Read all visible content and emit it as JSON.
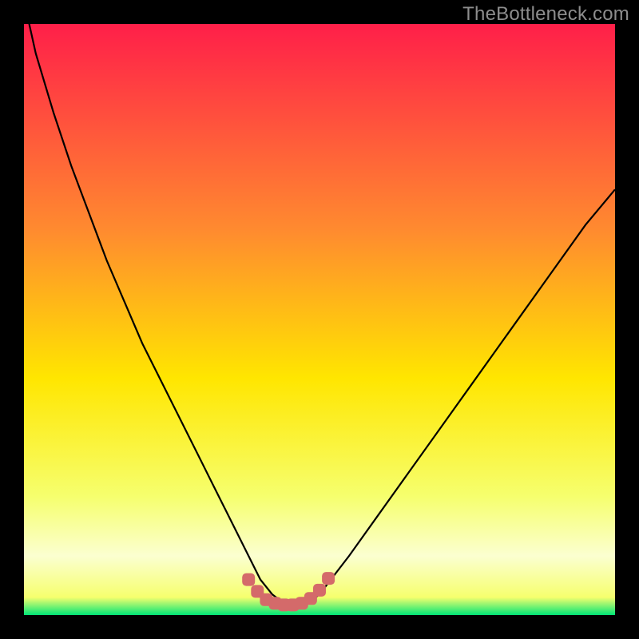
{
  "watermark": "TheBottleneck.com",
  "colors": {
    "frame": "#000000",
    "gradient_top": "#ff1f49",
    "gradient_mid_upper": "#ff8b2f",
    "gradient_mid": "#ffe600",
    "gradient_lower": "#f6ff6e",
    "gradient_band": "#fbffd0",
    "gradient_bottom": "#00e676",
    "curve": "#000000",
    "marker": "#d46a6a"
  },
  "chart_data": {
    "type": "line",
    "title": "",
    "xlabel": "",
    "ylabel": "",
    "xlim": [
      0,
      100
    ],
    "ylim": [
      0,
      100
    ],
    "grid": false,
    "series": [
      {
        "name": "bottleneck-curve",
        "x": [
          0,
          2,
          5,
          8,
          11,
          14,
          17,
          20,
          23,
          26,
          29,
          32,
          34,
          36,
          38,
          40,
          42,
          44,
          46,
          48,
          50,
          55,
          60,
          65,
          70,
          75,
          80,
          85,
          90,
          95,
          100
        ],
        "y": [
          104,
          95,
          85,
          76,
          68,
          60,
          53,
          46,
          40,
          34,
          28,
          22,
          18,
          14,
          10,
          6,
          3.5,
          2,
          1.5,
          2,
          3.5,
          10,
          17,
          24,
          31,
          38,
          45,
          52,
          59,
          66,
          72
        ]
      }
    ],
    "markers": {
      "name": "highlight-band",
      "x": [
        38,
        39.5,
        41,
        42.5,
        44,
        45.5,
        47,
        48.5,
        50,
        51.5
      ],
      "y": [
        6,
        4,
        2.6,
        2,
        1.7,
        1.7,
        2,
        2.8,
        4.2,
        6.2
      ]
    }
  }
}
